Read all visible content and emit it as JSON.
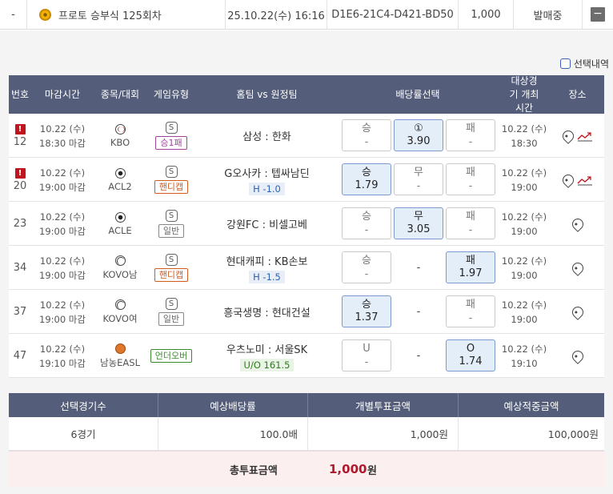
{
  "top_row": {
    "dash": "-",
    "title": "프로토 승부식 125회차",
    "datetime": "25.10.22(수) 16:16",
    "code": "D1E6-21C4-D421-BD50",
    "amount": "1,000",
    "status": "발매중",
    "collapse": "−"
  },
  "select_history": "선택내역",
  "headers": {
    "no": "번호",
    "deadline": "마감시간",
    "league": "종목/대회",
    "game_type": "게임유형",
    "teams": "홈팀 vs 원정팀",
    "odds": "배당률선택",
    "target_time": "대상경기 개최시간",
    "place": "장소"
  },
  "rows": [
    {
      "alert": "!",
      "no": "12",
      "date": "10.22 (수)",
      "close": "18:30 마감",
      "sport_icon": "baseball-icon",
      "league": "KBO",
      "s": "S",
      "type": "승1패",
      "type_color": "purple",
      "teams": "삼성 : 한화",
      "handicap": "",
      "opt1": {
        "label": "승",
        "odd": "-",
        "selected": false
      },
      "opt2": {
        "label": "①",
        "odd": "3.90",
        "selected": true
      },
      "opt3": {
        "label": "패",
        "odd": "-",
        "selected": false
      },
      "game_date": "10.22 (수)",
      "game_time": "18:30",
      "trend": true
    },
    {
      "alert": "!",
      "no": "20",
      "date": "10.22 (수)",
      "close": "19:00 마감",
      "sport_icon": "soccer-ball-icon",
      "league": "ACL2",
      "s": "S",
      "type": "핸디캡",
      "type_color": "orange",
      "teams": "G오사카 : 텝싸남딘",
      "handicap": "H -1.0",
      "opt1": {
        "label": "승",
        "odd": "1.79",
        "selected": true
      },
      "opt2": {
        "label": "무",
        "odd": "-",
        "selected": false
      },
      "opt3": {
        "label": "패",
        "odd": "-",
        "selected": false
      },
      "game_date": "10.22 (수)",
      "game_time": "19:00",
      "trend": true
    },
    {
      "alert": "",
      "no": "23",
      "date": "10.22 (수)",
      "close": "19:00 마감",
      "sport_icon": "soccer-ball-icon",
      "league": "ACLE",
      "s": "S",
      "type": "일반",
      "type_color": "gray",
      "teams": "강원FC : 비셀고베",
      "handicap": "",
      "opt1": {
        "label": "승",
        "odd": "-",
        "selected": false
      },
      "opt2": {
        "label": "무",
        "odd": "3.05",
        "selected": true
      },
      "opt3": {
        "label": "패",
        "odd": "-",
        "selected": false
      },
      "game_date": "10.22 (수)",
      "game_time": "19:00",
      "trend": false
    },
    {
      "alert": "",
      "no": "34",
      "date": "10.22 (수)",
      "close": "19:00 마감",
      "sport_icon": "volleyball-icon",
      "league": "KOVO남",
      "s": "S",
      "type": "핸디캡",
      "type_color": "orange",
      "teams": "현대캐피 : KB손보",
      "handicap": "H -1.5",
      "opt1": {
        "label": "승",
        "odd": "-",
        "selected": false
      },
      "opt2": null,
      "mid_dash": "-",
      "opt3": {
        "label": "패",
        "odd": "1.97",
        "selected": true
      },
      "game_date": "10.22 (수)",
      "game_time": "19:00",
      "trend": false
    },
    {
      "alert": "",
      "no": "37",
      "date": "10.22 (수)",
      "close": "19:00 마감",
      "sport_icon": "volleyball-icon",
      "league": "KOVO여",
      "s": "S",
      "type": "일반",
      "type_color": "gray",
      "teams": "흥국생명 : 현대건설",
      "handicap": "",
      "opt1": {
        "label": "승",
        "odd": "1.37",
        "selected": true
      },
      "opt2": null,
      "mid_dash": "-",
      "opt3": {
        "label": "패",
        "odd": "-",
        "selected": false
      },
      "game_date": "10.22 (수)",
      "game_time": "19:00",
      "trend": false
    },
    {
      "alert": "",
      "no": "47",
      "date": "10.22 (수)",
      "close": "19:10 마감",
      "sport_icon": "basketball-icon",
      "league": "남농EASL",
      "s": "",
      "type": "언더오버",
      "type_color": "green",
      "teams": "우츠노미 : 서울SK",
      "handicap": "U/O 161.5",
      "opt1": {
        "label": "U",
        "odd": "-",
        "selected": false
      },
      "opt2": null,
      "mid_dash": "-",
      "opt3": {
        "label": "O",
        "odd": "1.74",
        "selected": true
      },
      "game_date": "10.22 (수)",
      "game_time": "19:10",
      "trend": false
    }
  ],
  "summary": {
    "headers": [
      "선택경기수",
      "예상배당률",
      "개별투표금액",
      "예상적중금액"
    ],
    "values": [
      "6경기",
      "100.0배",
      "1,000원",
      "100,000원"
    ],
    "total_label": "총투표금액",
    "total_amount": "1,000",
    "total_unit": "원"
  },
  "colors": {
    "header_bg": "#545d79",
    "selected_bg": "#e4eef9",
    "alert": "#c0141e",
    "total_amount": "#b0182b"
  }
}
